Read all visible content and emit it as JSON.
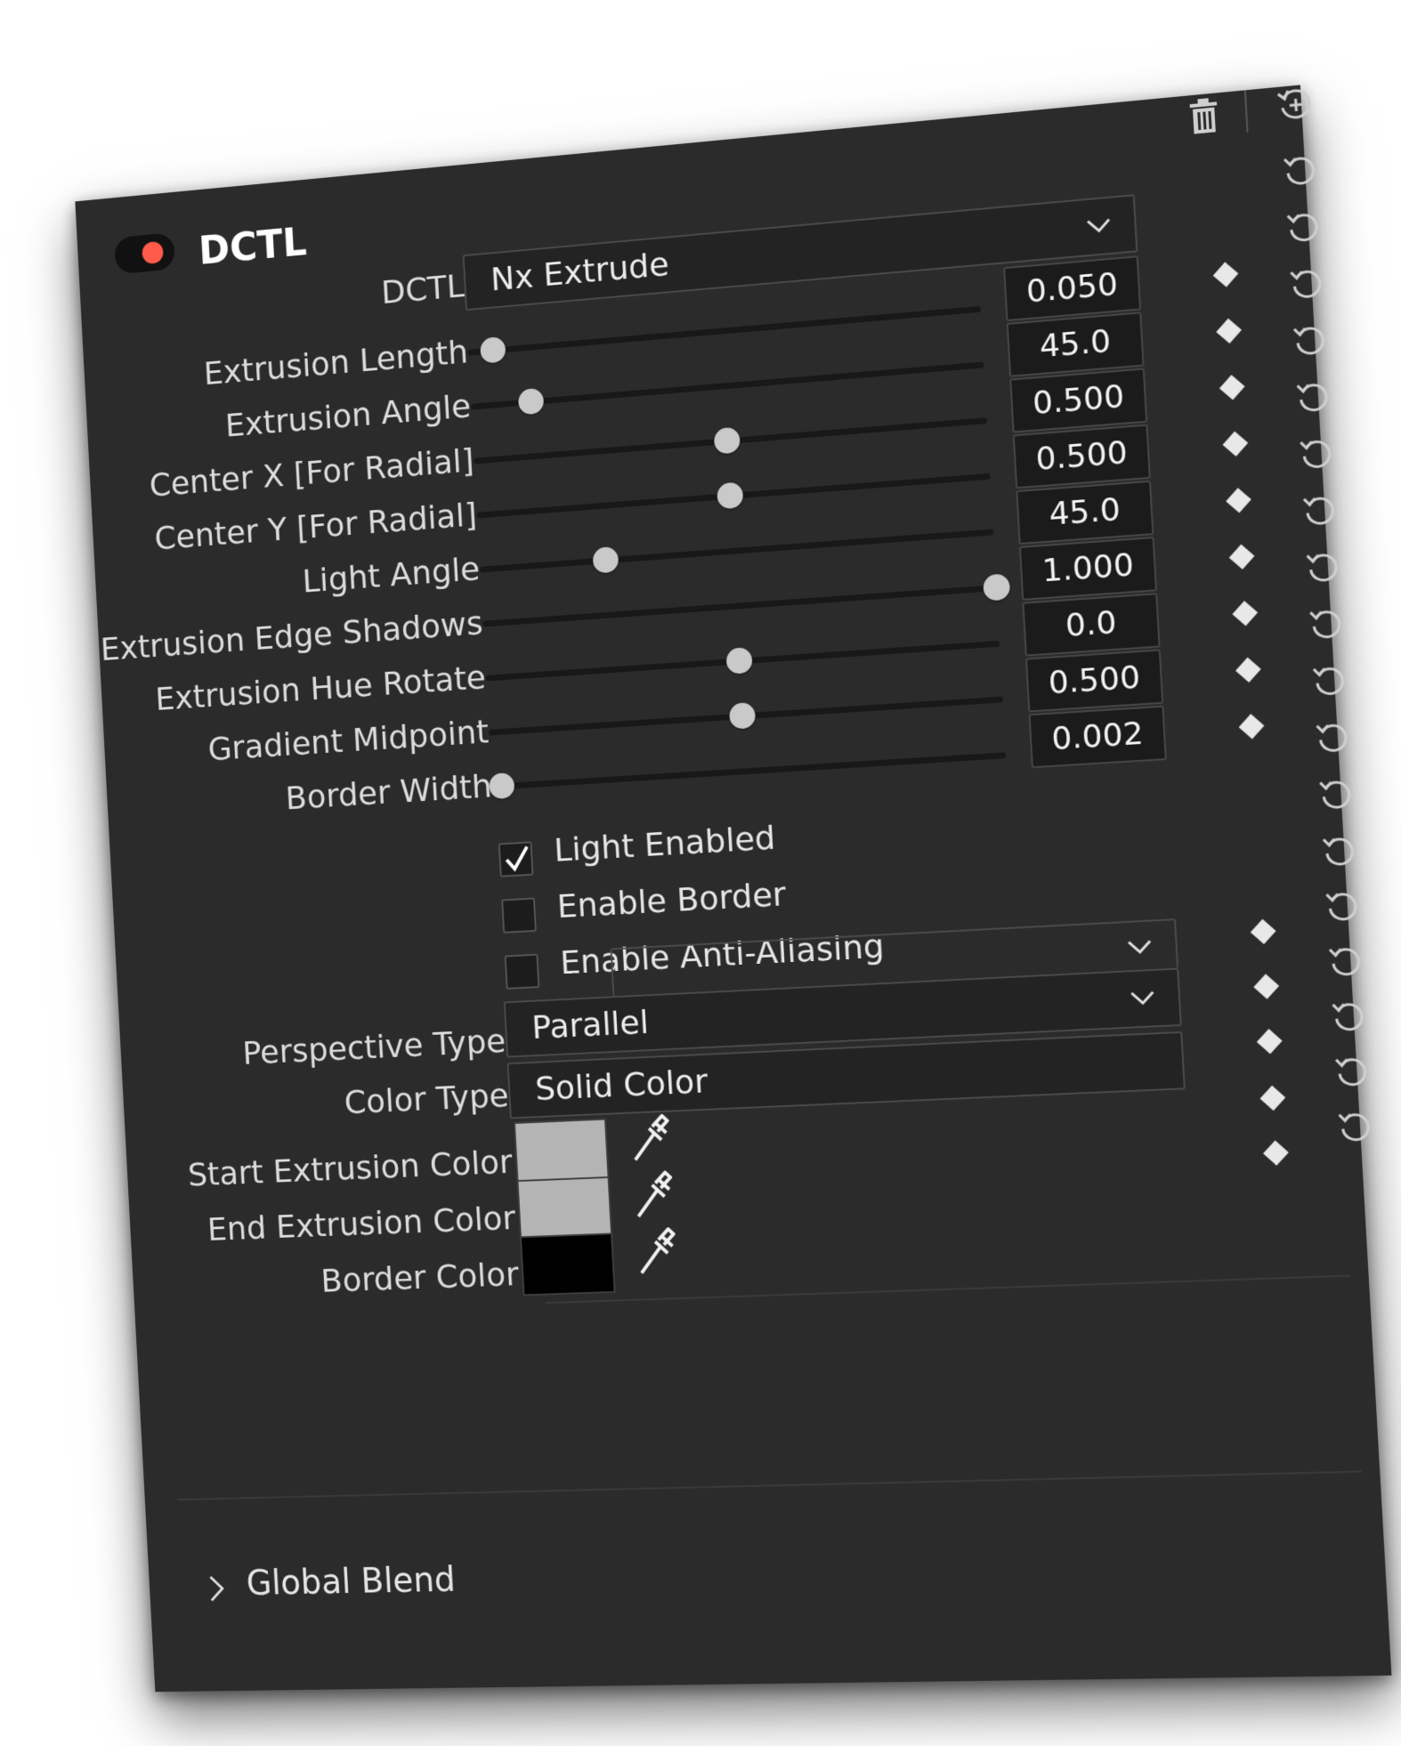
{
  "header": {
    "title": "DCTL",
    "enabled": true,
    "accent_color": "#ff5a4a"
  },
  "dctl": {
    "label": "DCTL",
    "selected": "Nx Extrude"
  },
  "sliders": [
    {
      "label": "Extrusion Length",
      "value": "0.050",
      "position": 0.05
    },
    {
      "label": "Extrusion Angle",
      "value": "45.0",
      "position": 0.12
    },
    {
      "label": "Center X [For Radial]",
      "value": "0.500",
      "position": 0.5
    },
    {
      "label": "Center Y [For Radial]",
      "value": "0.500",
      "position": 0.5
    },
    {
      "label": "Light Angle",
      "value": "45.0",
      "position": 0.25
    },
    {
      "label": "Extrusion Edge Shadows",
      "value": "1.000",
      "position": 1.0
    },
    {
      "label": "Extrusion Hue Rotate",
      "value": "0.0",
      "position": 0.5
    },
    {
      "label": "Gradient Midpoint",
      "value": "0.500",
      "position": 0.5
    },
    {
      "label": "Border Width",
      "value": "0.002",
      "position": 0.02
    }
  ],
  "checkboxes": [
    {
      "label": "Light Enabled",
      "checked": true
    },
    {
      "label": "Enable Border",
      "checked": false
    },
    {
      "label": "Enable Anti-Aliasing",
      "checked": false
    }
  ],
  "perspective": {
    "label": "Perspective Type",
    "selected": "Parallel"
  },
  "color_type": {
    "label": "Color Type",
    "selected": "Solid Color"
  },
  "colors": [
    {
      "label": "Start Extrusion Color",
      "color": "#b4b4b4"
    },
    {
      "label": "End Extrusion Color",
      "color": "#b4b4b4"
    },
    {
      "label": "Border Color",
      "color": "#000000"
    }
  ],
  "footer": {
    "label": "Global Blend"
  },
  "icons": {
    "delete": "trash-icon",
    "reset_all": "reset-all-icon",
    "reset": "reset-icon",
    "keyframe": "keyframe-diamond-icon",
    "dropdown": "chevron-down-icon",
    "picker": "eyedropper-icon",
    "expand": "chevron-right-icon"
  }
}
